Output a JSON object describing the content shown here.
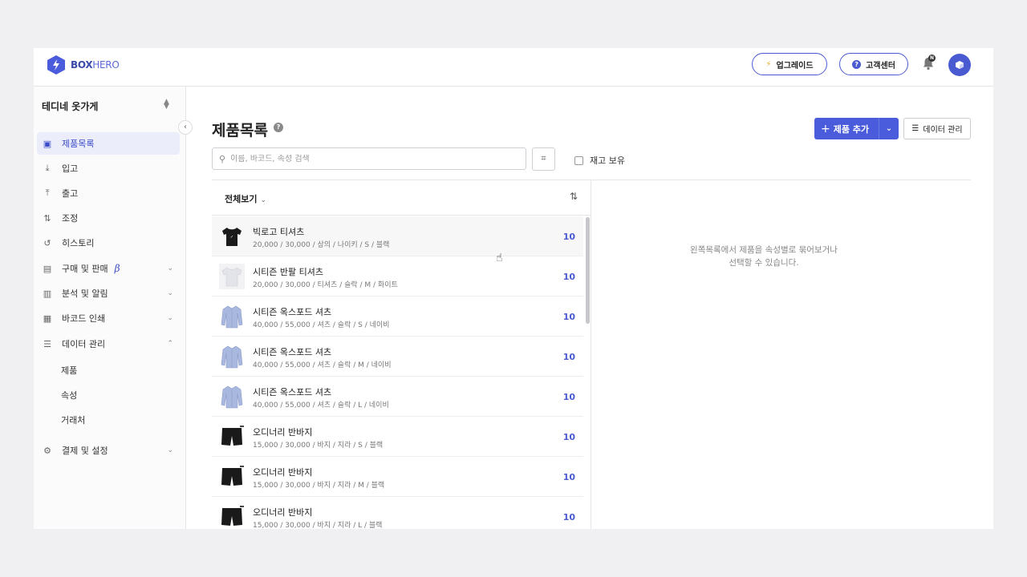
{
  "brand": {
    "name_bold": "BOX",
    "name_light": "HERO",
    "accent": "#4a5bdc"
  },
  "header": {
    "upgrade_label": "업그레이드",
    "help_label": "고객센터",
    "notification_badge": "N"
  },
  "sidebar": {
    "store_name": "테디네 옷가게",
    "items": [
      {
        "label": "제품목록",
        "icon": "box-icon",
        "active": true
      },
      {
        "label": "입고",
        "icon": "arrow-down-icon"
      },
      {
        "label": "출고",
        "icon": "arrow-up-icon"
      },
      {
        "label": "조정",
        "icon": "adjust-icon"
      },
      {
        "label": "히스토리",
        "icon": "history-icon"
      },
      {
        "label": "구매 및 판매",
        "icon": "document-icon",
        "badge": "β"
      },
      {
        "label": "분석 및 알림",
        "icon": "chart-icon"
      },
      {
        "label": "바코드 인쇄",
        "icon": "barcode-icon"
      },
      {
        "label": "데이터 관리",
        "icon": "database-icon",
        "expanded": true
      },
      {
        "label": "결제 및 설정",
        "icon": "gear-icon"
      }
    ],
    "sub_items": [
      "제품",
      "속성",
      "거래처"
    ]
  },
  "main": {
    "title": "제품목록",
    "add_button": "제품 추가",
    "data_button": "데이터 관리",
    "search_placeholder": "이름, 바코드, 속성 검색",
    "stock_filter_label": "재고 보유",
    "view_all_label": "전체보기",
    "empty_message_line1": "왼쪽목록에서 제품을 속성별로 묶어보거나",
    "empty_message_line2": "선택할 수 있습니다."
  },
  "products": [
    {
      "name": "빅로고 티셔츠",
      "meta": "20,000 / 30,000 / 상의 / 나이키 / S / 블랙",
      "qty": "10",
      "thumb": "black-tshirt"
    },
    {
      "name": "시티즌 반팔 티셔츠",
      "meta": "20,000 / 30,000 / 티셔츠 / 슬락 / M / 화이트",
      "qty": "10",
      "thumb": "white-tshirt"
    },
    {
      "name": "시티즌 옥스포드 셔츠",
      "meta": "40,000 / 55,000 / 셔츠 / 슬락 / S / 네이비",
      "qty": "10",
      "thumb": "blue-shirt"
    },
    {
      "name": "시티즌 옥스포드 셔츠",
      "meta": "40,000 / 55,000 / 셔츠 / 슬락 / M / 네이비",
      "qty": "10",
      "thumb": "blue-shirt"
    },
    {
      "name": "시티즌 옥스포드 셔츠",
      "meta": "40,000 / 55,000 / 셔츠 / 슬락 / L / 네이비",
      "qty": "10",
      "thumb": "blue-shirt"
    },
    {
      "name": "오디너리 반바지",
      "meta": "15,000 / 30,000 / 바지 / 지라 / S / 블랙",
      "qty": "10",
      "thumb": "black-shorts"
    },
    {
      "name": "오디너리 반바지",
      "meta": "15,000 / 30,000 / 바지 / 지라 / M / 블랙",
      "qty": "10",
      "thumb": "black-shorts"
    },
    {
      "name": "오디너리 반바지",
      "meta": "15,000 / 30,000 / 바지 / 지라 / L / 블랙",
      "qty": "10",
      "thumb": "black-shorts"
    }
  ]
}
